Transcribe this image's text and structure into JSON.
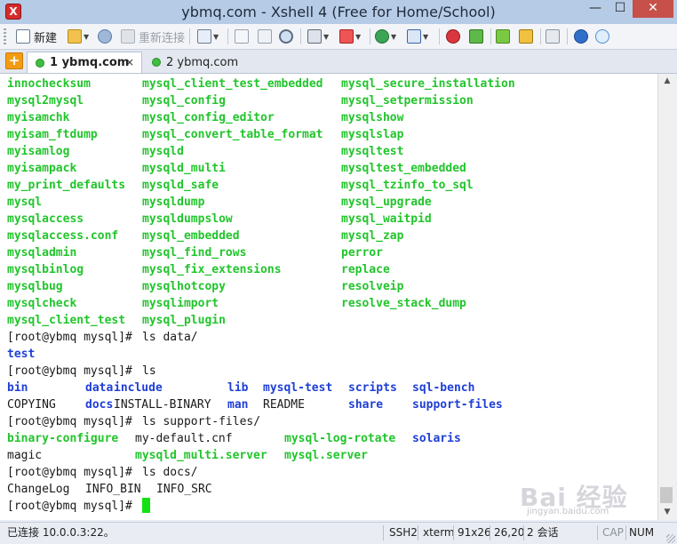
{
  "window": {
    "title": "ybmq.com - Xshell 4 (Free for Home/School)",
    "app_icon": "X",
    "min_glyph": "—",
    "max_glyph": "☐",
    "close_glyph": "✕"
  },
  "toolbar": {
    "new_label": "新建",
    "reconnect_label": "重新连接"
  },
  "tabs": {
    "add_glyph": "+",
    "items": [
      {
        "label": "1 ybmq.com",
        "active": true
      },
      {
        "label": "2 ybmq.com",
        "active": false
      }
    ],
    "close_glyph": "×"
  },
  "terminal": {
    "cols": [
      [
        "innochecksum",
        "mysql2mysql",
        "myisamchk",
        "myisam_ftdump",
        "myisamlog",
        "myisampack",
        "my_print_defaults",
        "mysql",
        "mysqlaccess",
        "mysqlaccess.conf",
        "mysqladmin",
        "mysqlbinlog",
        "mysqlbug",
        "mysqlcheck",
        "mysql_client_test"
      ],
      [
        "mysql_client_test_embedded",
        "mysql_config",
        "mysql_config_editor",
        "mysql_convert_table_format",
        "mysqld",
        "mysqld_multi",
        "mysqld_safe",
        "mysqldump",
        "mysqldumpslow",
        "mysql_embedded",
        "mysql_find_rows",
        "mysql_fix_extensions",
        "mysqlhotcopy",
        "mysqlimport",
        "mysql_plugin"
      ],
      [
        "mysql_secure_installation",
        "mysql_setpermission",
        "mysqlshow",
        "mysqlslap",
        "mysqltest",
        "mysqltest_embedded",
        "mysql_tzinfo_to_sql",
        "mysql_upgrade",
        "mysql_waitpid",
        "mysql_zap",
        "perror",
        "replace",
        "resolveip",
        "resolve_stack_dump"
      ]
    ],
    "prompt": "[root@ybmq mysql]# ",
    "cmd1": "ls data/",
    "out1": "test",
    "cmd2": "ls",
    "ls_row1": [
      "bin",
      "data",
      "include",
      "lib",
      "mysql-test",
      "scripts",
      "sql-bench"
    ],
    "ls_row2": [
      "COPYING",
      "docs",
      "INSTALL-BINARY",
      "man",
      "README",
      "share",
      "support-files"
    ],
    "cmd3": "ls support-files/",
    "sf_row1": [
      "binary-configure",
      "my-default.cnf",
      "mysql-log-rotate",
      "solaris"
    ],
    "sf_row2": [
      "magic",
      "mysqld_multi.server",
      "mysql.server"
    ],
    "cmd4": "ls docs/",
    "docs_row": [
      "ChangeLog",
      "INFO_BIN",
      "INFO_SRC"
    ]
  },
  "watermark": {
    "logo": "Bai 经验",
    "sub": "jingyan.baidu.com"
  },
  "status": {
    "connection": "已连接 10.0.0.3:22。",
    "protocol": "SSH2",
    "term": "xterm",
    "size": "91x26",
    "cursor": "26,20",
    "sessions": "2 会话",
    "caps": "CAP",
    "num": "NUM"
  }
}
